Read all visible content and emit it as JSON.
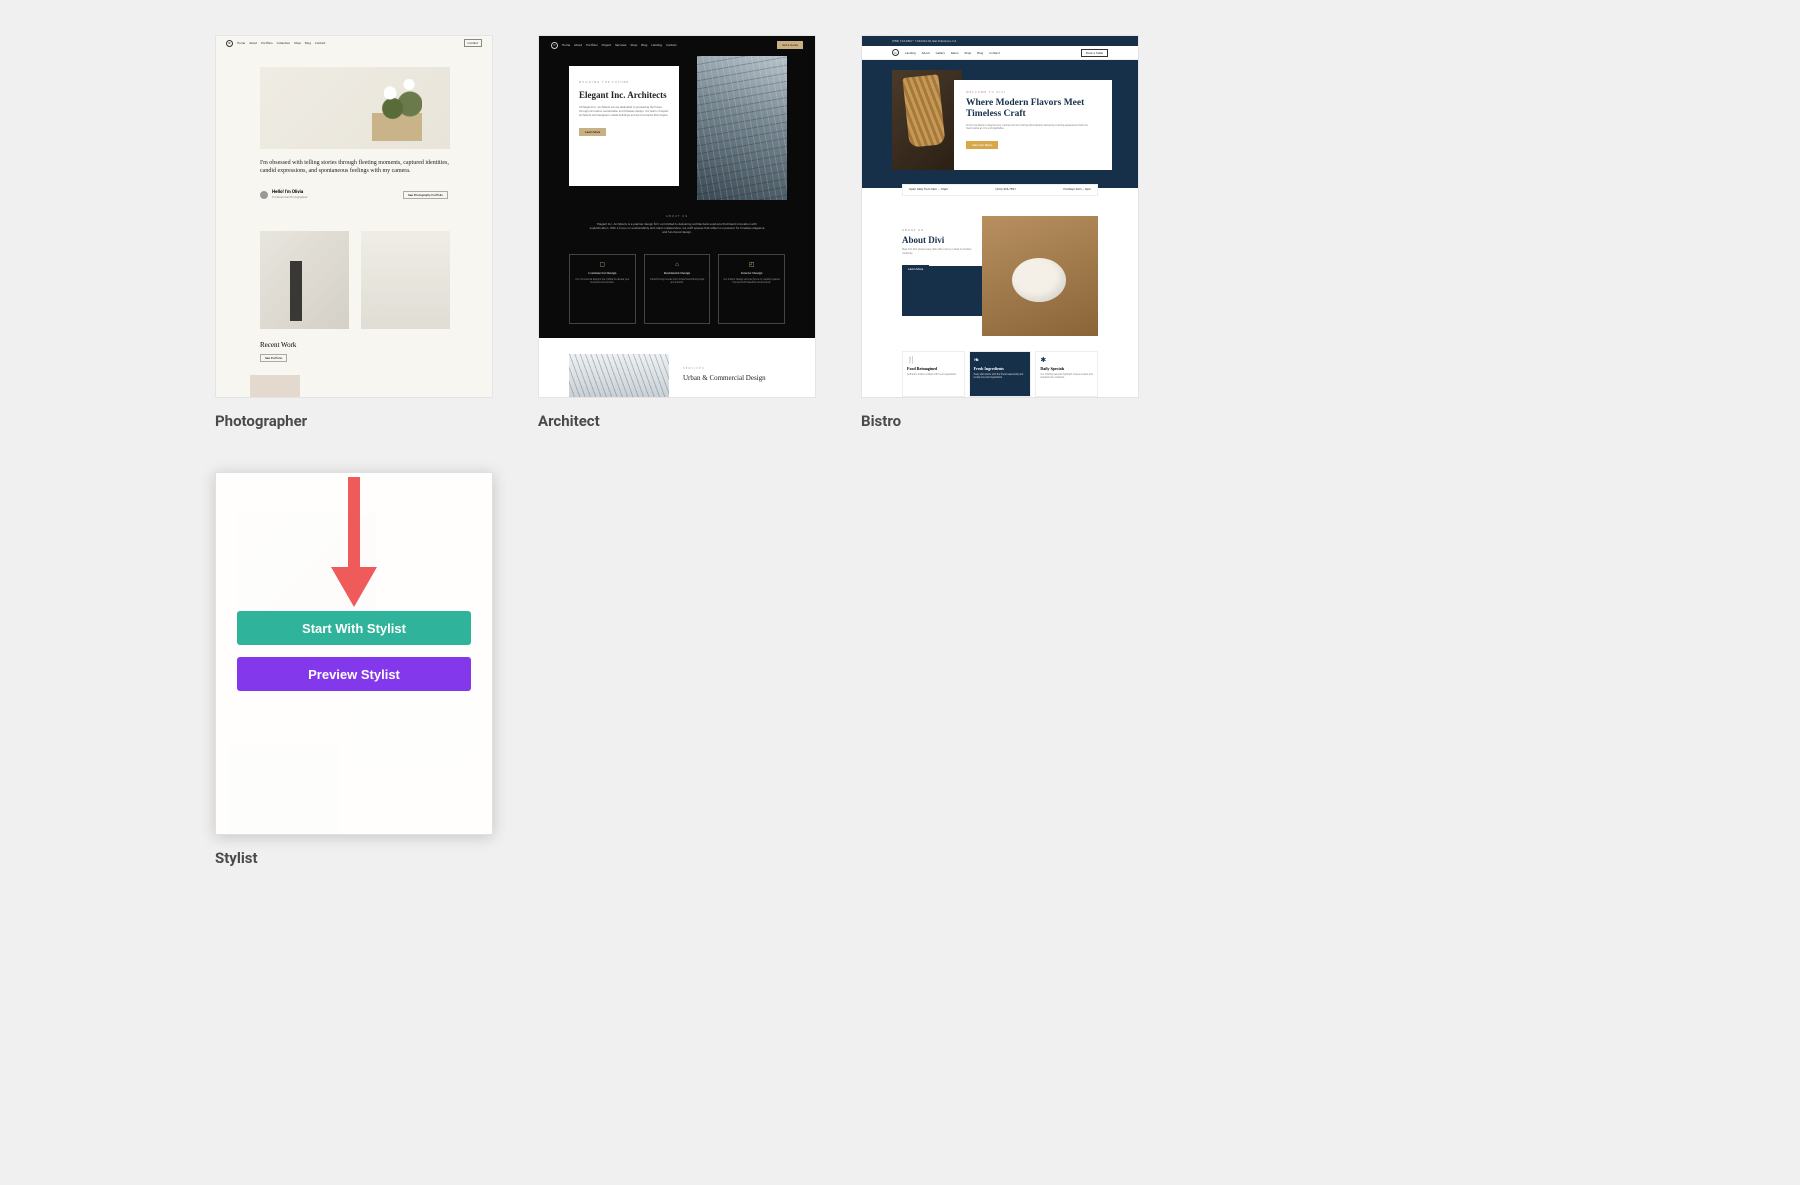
{
  "templates": [
    {
      "id": "photographer",
      "title": "Photographer"
    },
    {
      "id": "architect",
      "title": "Architect"
    },
    {
      "id": "bistro",
      "title": "Bistro"
    },
    {
      "id": "stylist",
      "title": "Stylist"
    }
  ],
  "photographer": {
    "nav": [
      "Home",
      "About",
      "Portfolio",
      "Collection",
      "Shop",
      "Blog",
      "Contact"
    ],
    "nav_cta": "Contact",
    "quote": "I'm obsessed with telling stories through fleeting moments, captured identities, candid expressions, and spontaneous feelings with my camera.",
    "author_name": "Hello! I'm Olivia",
    "author_sub": "Professional Photographer",
    "author_btn": "See Photography Portfolio",
    "recent_heading": "Recent Work",
    "recent_btn": "See Portfolio"
  },
  "architect": {
    "nav": [
      "Home",
      "About",
      "Portfolio",
      "Project",
      "Services",
      "Shop",
      "Blog",
      "Landing",
      "Contact"
    ],
    "nav_cta": "Get a Quote",
    "hero_sub": "BUILDING THE FUTURE",
    "hero_title": "Elegant Inc. Architects",
    "hero_btn": "Learn More",
    "about_label": "ABOUT US",
    "about_text": "Elegant Inc. Architects is a premier design firm committed to delivering architectural solutions that blend innovation with sophistication. With a focus on sustainability and client collaboration, we craft spaces that reflect our passion for timeless elegance and functional design.",
    "cards": [
      {
        "icon": "▢",
        "title": "Commercial Design",
        "desc": "Our commercial designs are crafted to elevate your business environment."
      },
      {
        "icon": "⌂",
        "title": "Residential Design",
        "desc": "Transforming houses into homes that embody style and warmth."
      },
      {
        "icon": "◰",
        "title": "Interior Design",
        "desc": "Our interior design services focus on creating spaces that are both beautiful and practical."
      }
    ],
    "bottom_sub": "SERVICES",
    "bottom_title": "Urban & Commercial Design"
  },
  "bistro": {
    "bar1_text": "(555) 123-4567 • 1234 Divi St, San Francisco, CA",
    "nav": [
      "Landing",
      "About",
      "Gallery",
      "Menu",
      "Shop",
      "Blog",
      "Contact"
    ],
    "nav_cta": "Book a Table",
    "hero_sub": "WELCOME TO DIVI",
    "hero_title": "Where Modern Flavors Meet Timeless Craft",
    "hero_btn": "View Our Menu",
    "info_left": "Open Daily from 9am – 10pm",
    "info_mid": "(234) 456-7891",
    "info_right": "Holidays 9am – 6pm",
    "about_sub": "ABOUT US",
    "about_title": "About Divi",
    "about_btn": "Learn More",
    "features": [
      {
        "icon": "🍴",
        "title": "Food Reimagined",
        "desc": "Authentic dishes crafted with local ingredients."
      },
      {
        "icon": "❧",
        "title": "Fresh Ingredients",
        "desc": "Every dish starts with the finest seasonally and locally sourced ingredients."
      },
      {
        "icon": "✱",
        "title": "Daily Specials",
        "desc": "Our rotating specials highlight unique recipes and inspired new creations."
      }
    ]
  },
  "stylist": {
    "start_label": "Start With Stylist",
    "preview_label": "Preview Stylist"
  },
  "colors": {
    "start_button": "#2fb39a",
    "preview_button": "#8338eb",
    "arrow": "#ef5b5b"
  }
}
